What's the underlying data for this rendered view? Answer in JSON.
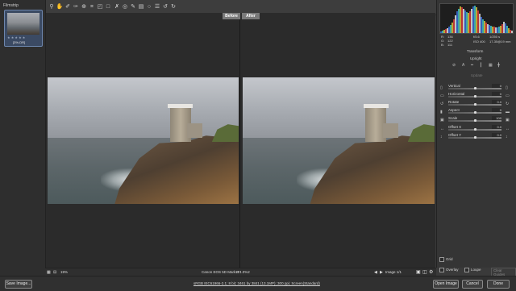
{
  "filmstrip": {
    "title": "Filmstrip",
    "thumb_name": "[3%-DR]",
    "thumb_stars": "★ ★ ★ ★ ★"
  },
  "toolbar": {
    "tools": [
      "zoom-icon",
      "hand-icon",
      "white-balance-icon",
      "color-sampler-icon",
      "target-adjust-icon",
      "crop-icon",
      "straighten-icon",
      "transform-icon",
      "spot-removal-icon",
      "red-eye-icon",
      "adjustment-brush-icon",
      "graduated-filter-icon",
      "radial-filter-icon",
      "preferences-icon",
      "rotate-ccw-icon",
      "rotate-cw-icon"
    ]
  },
  "viewer": {
    "before_label": "Before",
    "after_label": "After"
  },
  "statusbar": {
    "zoom": "19%",
    "camera": "Canon EOS 5D Mark II",
    "exposure": "174.0%2",
    "image_counter": "Image 1/1"
  },
  "right_panel": {
    "readout": {
      "r_label": "R:",
      "r_val": "136",
      "g_label": "G:",
      "g_val": "122",
      "b_label": "B:",
      "b_val": "111",
      "aperture": "f/5.6",
      "shutter": "1/250 s",
      "iso": "ISO 400",
      "lens": "17-35@19 mm"
    },
    "section_title": "Transform",
    "upright_label": "Upright",
    "update_label": "Update",
    "sliders": [
      {
        "label": "Vertical",
        "value": "0",
        "fraction": 0.5
      },
      {
        "label": "Horizontal",
        "value": "0",
        "fraction": 0.5
      },
      {
        "label": "Rotate",
        "value": "0.0",
        "fraction": 0.5
      },
      {
        "label": "Aspect",
        "value": "0",
        "fraction": 0.5
      },
      {
        "label": "Scale",
        "value": "100",
        "fraction": 0.5
      },
      {
        "label": "Offset X",
        "value": "0.0",
        "fraction": 0.5
      },
      {
        "label": "Offset Y",
        "value": "0.0",
        "fraction": 0.5
      }
    ],
    "grid_label": "Grid",
    "overlay_label": "Overlay",
    "loupe_label": "Loupe",
    "clear_guides_label": "Clear Guides"
  },
  "footer": {
    "save_label": "Save Image...",
    "workflow_link": "sRGB IEC61966-2.1; 8 bit; 3461 by 3841 (13.1MP); 300 ppi; Screen(Standard)",
    "open_label": "Open Image",
    "cancel_label": "Cancel",
    "done_label": "Done"
  },
  "colors": {
    "accent": "#6d86ad",
    "panel_bg": "#353535",
    "viewer_bg": "#2b2b2b"
  }
}
